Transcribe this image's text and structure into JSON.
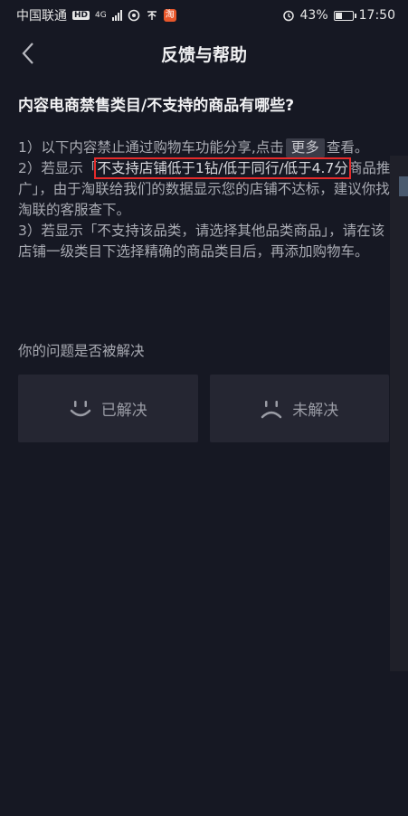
{
  "status_bar": {
    "carrier": "中国联通",
    "hd": "HD",
    "network": "4G",
    "battery": "43%",
    "battery_level": 0.43,
    "time": "17:50",
    "app_badge": "淘"
  },
  "nav": {
    "title": "反馈与帮助"
  },
  "content": {
    "question": "内容电商禁售类目/不支持的商品有哪些?",
    "p1_before": "1）以下内容禁止通过购物车功能分享,点击",
    "more_label": "更多",
    "p1_after": "查看。",
    "p2_before": "2）若显示「",
    "p2_highlight": "不支持店铺低于1钻/低于同行/低于4.7分",
    "p2_after": "商品推广」，由于淘联给我们的数据显示您的店铺不达标，建议你找淘联的客服查下。",
    "p3": "3）若显示「不支持该品类，请选择其他品类商品」，请在该店铺一级类目下选择精确的商品类目后，再添加购物车。"
  },
  "feedback": {
    "question": "你的问题是否被解决",
    "solved_label": "已解决",
    "unsolved_label": "未解决"
  }
}
